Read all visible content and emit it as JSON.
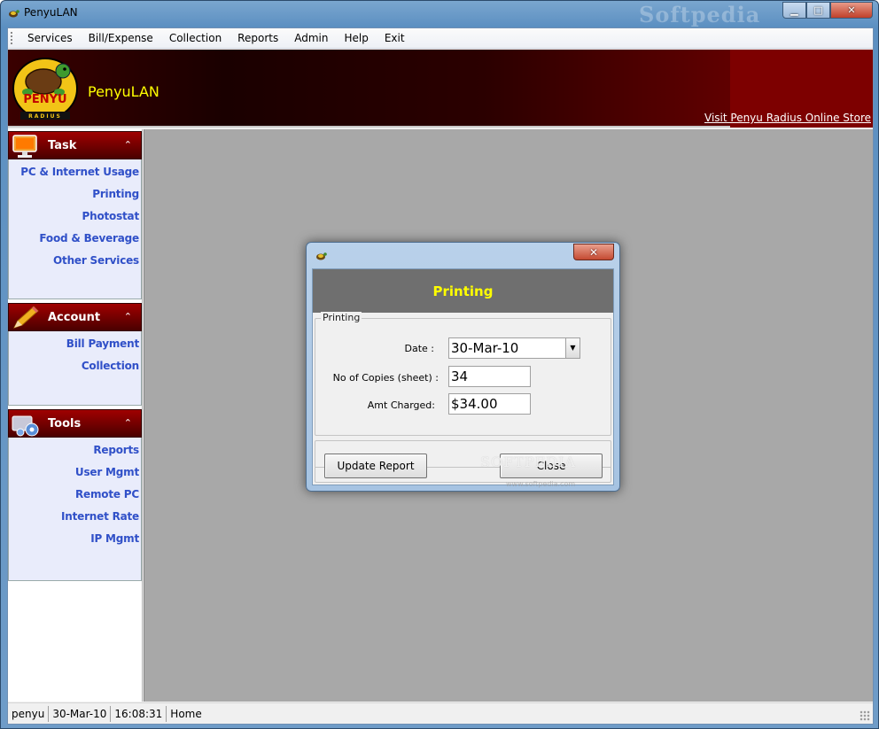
{
  "window": {
    "title": "PenyuLAN",
    "watermark": "Softpedia",
    "minimize_glyph": "▁",
    "maximize_glyph": "□",
    "close_glyph": "✕"
  },
  "menu": [
    "Services",
    "Bill/Expense",
    "Collection",
    "Reports",
    "Admin",
    "Help",
    "Exit"
  ],
  "banner": {
    "app_name": "PenyuLAN",
    "logo_text": "PENYU",
    "logo_subtext": "RADIUS",
    "store_link": "Visit Penyu Radius Online Store"
  },
  "sidebar": {
    "task": {
      "title": "Task",
      "collapse_glyph": "⌃",
      "items": [
        "PC & Internet Usage",
        "Printing",
        "Photostat",
        "Food & Beverage",
        "Other Services"
      ]
    },
    "account": {
      "title": "Account",
      "collapse_glyph": "⌃",
      "items": [
        "Bill Payment",
        "Collection"
      ]
    },
    "tools": {
      "title": "Tools",
      "collapse_glyph": "⌃",
      "items": [
        "Reports",
        "User Mgmt",
        "Remote PC",
        "Internet Rate",
        "IP Mgmt"
      ]
    }
  },
  "status": {
    "user": "penyu",
    "date": "30-Mar-10",
    "time": "16:08:31",
    "location": "Home"
  },
  "dialog": {
    "close_glyph": "✕",
    "header": "Printing",
    "group_title": "Printing",
    "date_label": "Date :",
    "date_value": "30-Mar-10",
    "combo_arrow": "▼",
    "copies_label": "No of Copies (sheet) :",
    "copies_value": "34",
    "amount_label": "Amt Charged:",
    "amount_value": "$34.00",
    "update_button": "Update Report",
    "close_button": "Close",
    "watermark": "SOFTPEDIA",
    "watermark_url": "www.softpedia.com"
  },
  "colors": {
    "banner_red": "#7d0000",
    "link_blue": "#3050c8",
    "title_yellow": "#ffff00",
    "workspace_gray": "#a8a8a8"
  }
}
